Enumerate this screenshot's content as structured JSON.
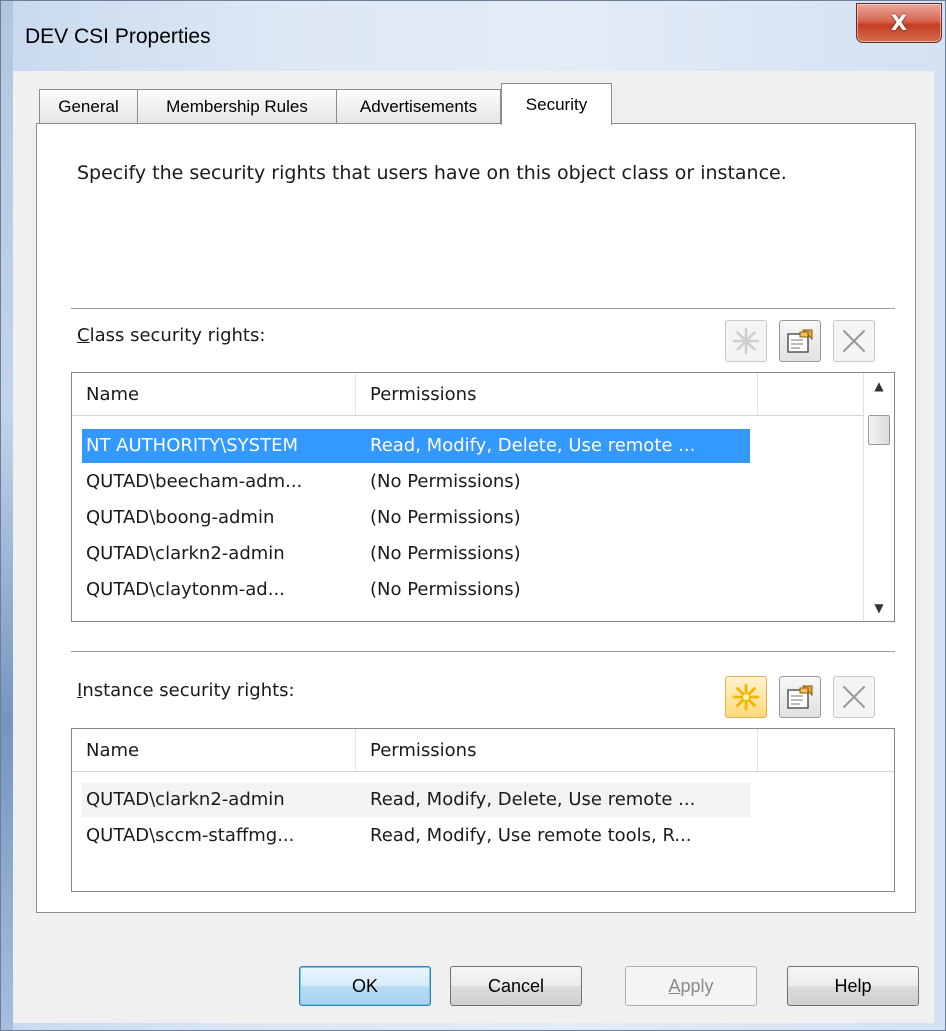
{
  "window": {
    "title": "DEV CSI Properties",
    "close_glyph": "X"
  },
  "tabs": [
    {
      "label": "General"
    },
    {
      "label": "Membership Rules"
    },
    {
      "label": "Advertisements"
    },
    {
      "label": "Security",
      "active": true
    }
  ],
  "panel": {
    "description": "Specify the security rights that users have on this object class or instance."
  },
  "class_rights": {
    "label_accel": "C",
    "label_rest": "lass security rights:",
    "columns": [
      "Name",
      "Permissions"
    ],
    "rows": [
      {
        "name": "NT AUTHORITY\\SYSTEM",
        "permissions": "Read, Modify, Delete, Use remote ...",
        "selected": true
      },
      {
        "name": "QUTAD\\beecham-adm...",
        "permissions": "(No Permissions)"
      },
      {
        "name": "QUTAD\\boong-admin",
        "permissions": "(No Permissions)"
      },
      {
        "name": "QUTAD\\clarkn2-admin",
        "permissions": "(No Permissions)"
      },
      {
        "name": "QUTAD\\claytonm-ad...",
        "permissions": "(No Permissions)"
      }
    ],
    "toolbar": {
      "new_icon": "sparkle-new-icon",
      "properties_icon": "properties-icon",
      "delete_icon": "delete-x-icon"
    }
  },
  "instance_rights": {
    "label_accel": "I",
    "label_rest": "nstance security rights:",
    "columns": [
      "Name",
      "Permissions"
    ],
    "rows": [
      {
        "name": "QUTAD\\clarkn2-admin",
        "permissions": "Read, Modify, Delete, Use remote ..."
      },
      {
        "name": "QUTAD\\sccm-staffmg...",
        "permissions": "Read, Modify, Use remote tools, R..."
      }
    ],
    "toolbar": {
      "new_icon": "sparkle-new-icon",
      "properties_icon": "properties-icon",
      "delete_icon": "delete-x-icon"
    }
  },
  "buttons": {
    "ok": "OK",
    "cancel": "Cancel",
    "apply_accel": "A",
    "apply_rest": "pply",
    "help": "Help"
  },
  "colors": {
    "selection": "#3399ff",
    "close_button": "#c33d22",
    "new_button_hot": "#ffd97a"
  }
}
